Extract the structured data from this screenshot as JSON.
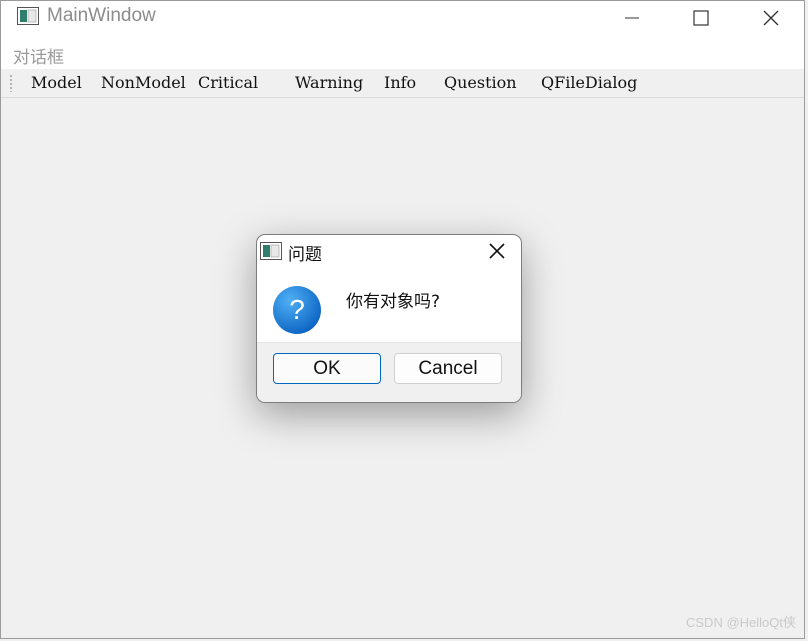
{
  "window": {
    "title": "MainWindow",
    "controls": [
      "minimize",
      "maximize",
      "close"
    ]
  },
  "menubar": {
    "items": [
      "对话框"
    ]
  },
  "toolbar": {
    "buttons": [
      "Model",
      "NonModel",
      "Critical",
      "Warning",
      "Info",
      "Question",
      "QFileDialog"
    ]
  },
  "dialog": {
    "title": "问题",
    "message": "你有对象吗?",
    "icon": "question-icon",
    "buttons": {
      "ok": "OK",
      "cancel": "Cancel"
    }
  },
  "watermark": "CSDN @HelloQt侠",
  "colors": {
    "accent": "#0067c0",
    "question_icon": "#1a7fd8",
    "window_bg": "#f0f0f0"
  }
}
